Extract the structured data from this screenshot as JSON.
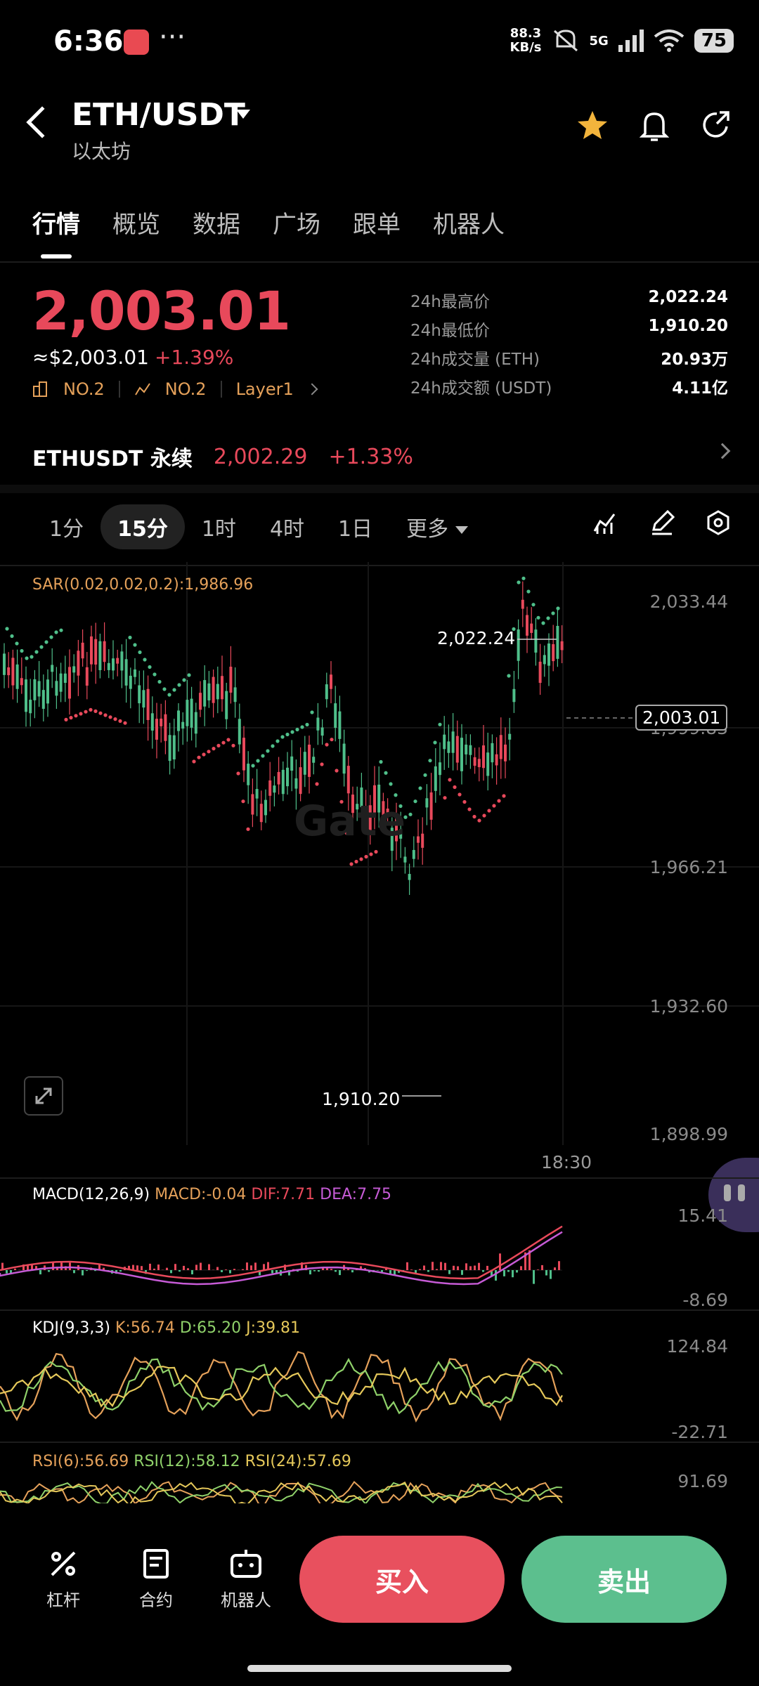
{
  "status_bar": {
    "time": "6:36",
    "dots": "···",
    "net_speed": "88.3",
    "net_unit": "KB/s",
    "signal": "5G",
    "battery": "75"
  },
  "header": {
    "pair": "ETH/USDT",
    "subtitle": "以太坊"
  },
  "tabs": [
    "行情",
    "概览",
    "数据",
    "广场",
    "跟单",
    "机器人"
  ],
  "price": {
    "last": "2,003.01",
    "usd": "≈$2,003.01",
    "change": "+1.39%",
    "tag1": "NO.2",
    "tag2": "NO.2",
    "tag3": "Layer1"
  },
  "stats": [
    {
      "label": "24h最高价",
      "value": "2,022.24"
    },
    {
      "label": "24h最低价",
      "value": "1,910.20"
    },
    {
      "label": "24h成交量 (ETH)",
      "value": "20.93万"
    },
    {
      "label": "24h成交额 (USDT)",
      "value": "4.11亿"
    }
  ],
  "perp": {
    "name": "ETHUSDT 永续",
    "price": "2,002.29",
    "change": "+1.33%"
  },
  "intervals": [
    "1分",
    "15分",
    "1时",
    "4时",
    "1日",
    "更多"
  ],
  "chart": {
    "sar_label": "SAR(0.02,0.02,0.2):1,986.96",
    "watermark": "Gate",
    "y_labels": [
      "2,033.44",
      "1,999.83",
      "1,966.21",
      "1,932.60",
      "1,898.99"
    ],
    "high_label": "2,022.24",
    "low_label": "1,910.20",
    "last_price_tag": "2,003.01",
    "x_label": "18:30",
    "accent_up": "#e8495b",
    "accent_down": "#4fbf8a"
  },
  "macd": {
    "title": "MACD(12,26,9)",
    "macd": "MACD:-0.04",
    "dif": "DIF:7.71",
    "dea": "DEA:7.75",
    "y_top": "15.41",
    "y_bottom": "-8.69"
  },
  "kdj": {
    "title": "KDJ(9,3,3)",
    "k": "K:56.74",
    "d": "D:65.20",
    "j": "J:39.81",
    "y_top": "124.84",
    "y_bottom": "-22.71"
  },
  "rsi": {
    "r6": "RSI(6):56.69",
    "r12": "RSI(12):58.12",
    "r24": "RSI(24):57.69",
    "y_top": "91.69"
  },
  "bottom": {
    "leverage": "杠杆",
    "contract": "合约",
    "robot": "机器人",
    "buy": "买入",
    "sell": "卖出"
  }
}
